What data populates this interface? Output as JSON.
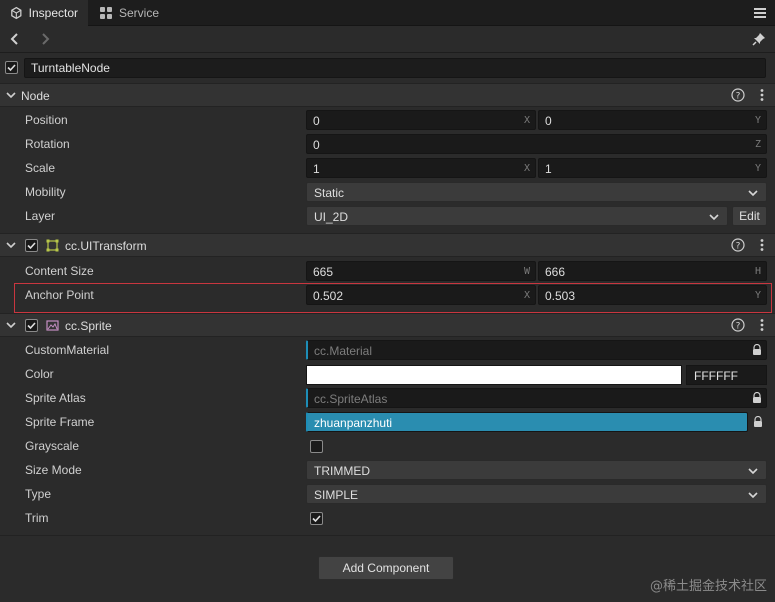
{
  "tabs": [
    {
      "label": "Inspector",
      "icon": "inspector-icon"
    },
    {
      "label": "Service",
      "icon": "service-icon"
    }
  ],
  "node": {
    "name": "TurntableNode",
    "enabled": true
  },
  "sections": {
    "node": {
      "title": "Node",
      "position": {
        "x": "0",
        "y": "0",
        "x_axis": "X",
        "y_axis": "Y"
      },
      "rotation": {
        "value": "0",
        "axis": "Z"
      },
      "scale": {
        "x": "1",
        "y": "1",
        "x_axis": "X",
        "y_axis": "Y"
      },
      "mobility": "Static",
      "layer": "UI_2D",
      "edit_label": "Edit",
      "labels": {
        "position": "Position",
        "rotation": "Rotation",
        "scale": "Scale",
        "mobility": "Mobility",
        "layer": "Layer"
      }
    },
    "ui_transform": {
      "title": "cc.UITransform",
      "enabled": true,
      "content_size": {
        "w": "665",
        "h": "666",
        "w_axis": "W",
        "h_axis": "H"
      },
      "anchor_point": {
        "x": "0.502",
        "y": "0.503",
        "x_axis": "X",
        "y_axis": "Y"
      },
      "labels": {
        "content_size": "Content Size",
        "anchor_point": "Anchor Point"
      }
    },
    "sprite": {
      "title": "cc.Sprite",
      "enabled": true,
      "custom_material": "cc.Material",
      "color_hex": "FFFFFF",
      "color_value": "#ffffff",
      "sprite_atlas": "cc.SpriteAtlas",
      "sprite_frame": "zhuanpanzhuti",
      "grayscale": false,
      "size_mode": "TRIMMED",
      "type": "SIMPLE",
      "trim": true,
      "labels": {
        "custom_material": "CustomMaterial",
        "color": "Color",
        "sprite_atlas": "Sprite Atlas",
        "sprite_frame": "Sprite Frame",
        "grayscale": "Grayscale",
        "size_mode": "Size Mode",
        "type": "Type",
        "trim": "Trim"
      }
    }
  },
  "add_component_label": "Add Component",
  "watermark": "@稀土掘金技术社区",
  "colors": {
    "accent": "#2a8db0",
    "highlight": "#c9363f",
    "background": "#2b2b2b"
  }
}
